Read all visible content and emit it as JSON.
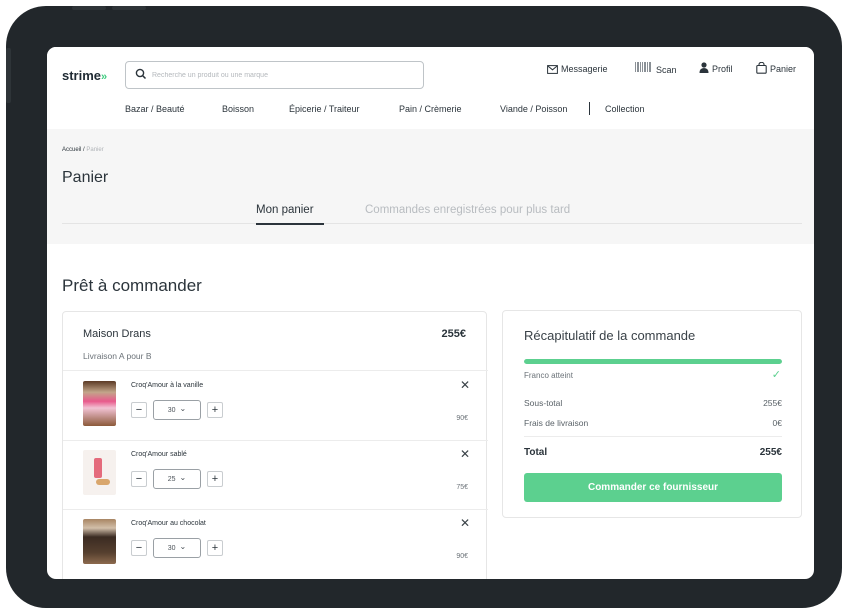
{
  "header": {
    "logo": "strime",
    "logo_chevrons": "»",
    "search_placeholder": "Recherche un produit ou une marque",
    "links": {
      "messages": "Messagerie",
      "scan": "Scan",
      "profile": "Profil",
      "cart": "Panier"
    },
    "nav": [
      "Bazar / Beauté",
      "Boisson",
      "Épicerie / Traiteur",
      "Pain / Crèmerie",
      "Viande / Poisson",
      "Collection"
    ]
  },
  "breadcrumb": {
    "home": "Accueil",
    "separator": " / ",
    "current": "Panier"
  },
  "page_title": "Panier",
  "tabs": {
    "active": "Mon panier",
    "inactive": "Commandes enregistrées pour plus tard"
  },
  "section_title": "Prêt à commander",
  "order": {
    "supplier": "Maison Drans",
    "supplier_total": "255€",
    "delivery": "Livraison A pour B",
    "items": [
      {
        "name": "Croq'Amour à la vanille",
        "qty": "30",
        "price": "90€",
        "thumb_color": "#8c5a3a"
      },
      {
        "name": "Croq'Amour sablé",
        "qty": "25",
        "price": "75€",
        "thumb_color": "#f1e4dc"
      },
      {
        "name": "Croq'Amour au chocolat",
        "qty": "30",
        "price": "90€",
        "thumb_color": "#6b4a33"
      }
    ],
    "remove_symbol": "✕",
    "minus": "−",
    "plus": "+",
    "caret": "⌄"
  },
  "summary": {
    "title": "Récapitulatif de la commande",
    "franco_label": "Franco atteint",
    "franco_progress": 1.0,
    "check": "✓",
    "subtotal_label": "Sous-total",
    "subtotal_value": "255€",
    "shipping_label": "Frais de livraison",
    "shipping_value": "0€",
    "total_label": "Total",
    "total_value": "255€",
    "order_button": "Commander ce fournisseur"
  },
  "colors": {
    "accent": "#5cd08f",
    "text": "#2b343b",
    "bezel": "#22272b"
  }
}
